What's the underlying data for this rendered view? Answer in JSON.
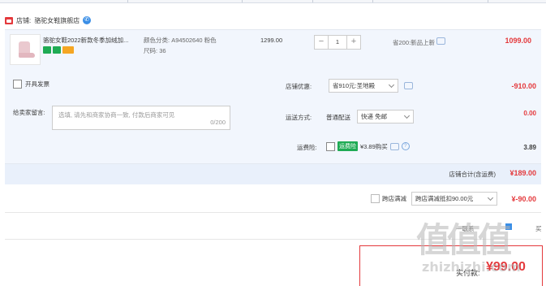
{
  "shop": {
    "label": "店铺:",
    "name": "骆驼女鞋旗舰店"
  },
  "item": {
    "title": "骆驼女鞋2022新款冬季加绒加...",
    "color_label": "颜色分类:",
    "color_value": "A94502640 粉色",
    "size_label": "尺码:",
    "size_value": "36",
    "original_price": "1299.00",
    "quantity": "1",
    "promo_text": "省200:新品上新",
    "subtotal": "1099.00",
    "tag_colors": [
      "#1fab54",
      "#1fab54",
      "#f5a623"
    ]
  },
  "options": {
    "invoice_label": "开具发票",
    "message_label": "给卖家留言:",
    "message_placeholder": "选填, 请先和商家协商一致, 付款后商家可见",
    "message_count": "0/200",
    "shop_discount_label": "店铺优惠:",
    "shop_discount_value": "省910元:圣地殿",
    "shop_discount_amount": "-910.00",
    "shipping_label": "运送方式:",
    "shipping_type": "普通配送",
    "shipping_value": "快递 免邮",
    "shipping_amount": "0.00",
    "insurance_label": "运费险:",
    "insurance_badge": "运费险",
    "insurance_text": "¥3.89购买",
    "insurance_amount": "3.89",
    "shop_total_label": "店铺合计(含运费)",
    "shop_total_value": "¥189.00"
  },
  "cross_discount": {
    "label": "跨店满减",
    "select_value": "跨店满减抵扣90.00元",
    "amount": "¥-90.00"
  },
  "footer_row": {
    "left_text": "一联系",
    "right_text": "买"
  },
  "final": {
    "label": "实付款:",
    "amount": "¥99.00"
  },
  "watermark": {
    "logo_chars": "值值值",
    "site": "zhizhizhi.com"
  },
  "colors": {
    "accent": "#e4393c",
    "panel": "#f2f6fd",
    "link": "#3a8ee6"
  }
}
